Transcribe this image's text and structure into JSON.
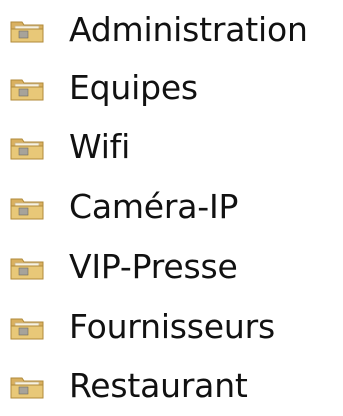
{
  "folders": [
    {
      "label": "Administration",
      "icon": "folder-icon"
    },
    {
      "label": "Equipes",
      "icon": "folder-icon"
    },
    {
      "label": "Wifi",
      "icon": "folder-icon"
    },
    {
      "label": "Caméra-IP",
      "icon": "folder-icon"
    },
    {
      "label": "VIP-Presse",
      "icon": "folder-icon"
    },
    {
      "label": "Fournisseurs",
      "icon": "folder-icon"
    },
    {
      "label": "Restaurant",
      "icon": "folder-icon"
    }
  ],
  "colors": {
    "folder_body": "#E8C878",
    "folder_tab": "#D9B060",
    "folder_border": "#B08A3A",
    "folder_paper": "#F7F2E3",
    "text": "#111111"
  }
}
